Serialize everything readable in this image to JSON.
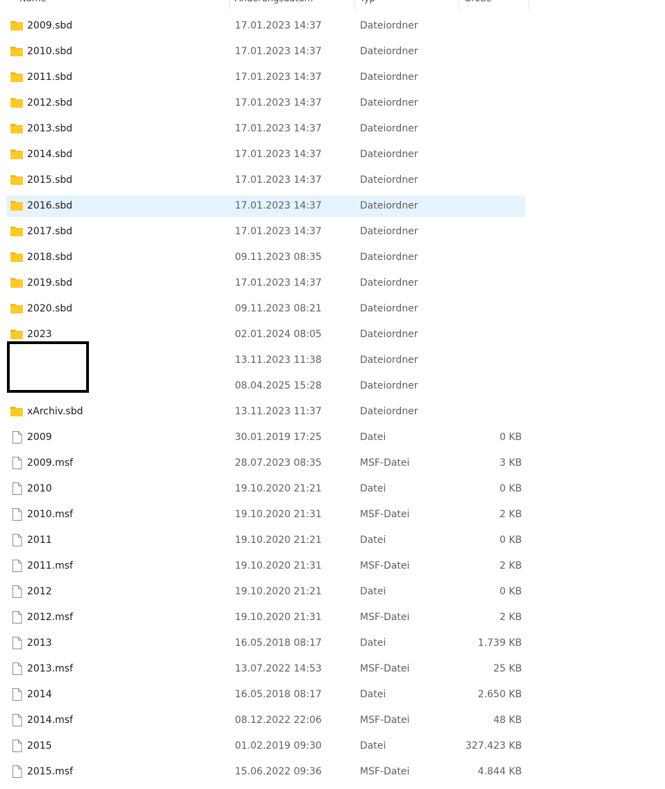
{
  "header": {
    "name": "Name",
    "date": "Änderungsdatum",
    "type": "Typ",
    "size": "Größe"
  },
  "rows": [
    {
      "name": "2009.sbd",
      "date": "17.01.2023 14:37",
      "type": "Dateiordner",
      "size": "",
      "icon": "folder-icon"
    },
    {
      "name": "2010.sbd",
      "date": "17.01.2023 14:37",
      "type": "Dateiordner",
      "size": "",
      "icon": "folder-icon"
    },
    {
      "name": "2011.sbd",
      "date": "17.01.2023 14:37",
      "type": "Dateiordner",
      "size": "",
      "icon": "folder-icon"
    },
    {
      "name": "2012.sbd",
      "date": "17.01.2023 14:37",
      "type": "Dateiordner",
      "size": "",
      "icon": "folder-icon"
    },
    {
      "name": "2013.sbd",
      "date": "17.01.2023 14:37",
      "type": "Dateiordner",
      "size": "",
      "icon": "folder-icon"
    },
    {
      "name": "2014.sbd",
      "date": "17.01.2023 14:37",
      "type": "Dateiordner",
      "size": "",
      "icon": "folder-icon"
    },
    {
      "name": "2015.sbd",
      "date": "17.01.2023 14:37",
      "type": "Dateiordner",
      "size": "",
      "icon": "folder-icon"
    },
    {
      "name": "2016.sbd",
      "date": "17.01.2023 14:37",
      "type": "Dateiordner",
      "size": "",
      "icon": "folder-icon",
      "selected": true
    },
    {
      "name": "2017.sbd",
      "date": "17.01.2023 14:37",
      "type": "Dateiordner",
      "size": "",
      "icon": "folder-icon"
    },
    {
      "name": "2018.sbd",
      "date": "09.11.2023 08:35",
      "type": "Dateiordner",
      "size": "",
      "icon": "folder-icon"
    },
    {
      "name": "2019.sbd",
      "date": "17.01.2023 14:37",
      "type": "Dateiordner",
      "size": "",
      "icon": "folder-icon"
    },
    {
      "name": "2020.sbd",
      "date": "09.11.2023 08:21",
      "type": "Dateiordner",
      "size": "",
      "icon": "folder-icon"
    },
    {
      "name": "2023",
      "date": "02.01.2024 08:05",
      "type": "Dateiordner",
      "size": "",
      "icon": "folder-icon"
    },
    {
      "name": "",
      "date": "13.11.2023 11:38",
      "type": "Dateiordner",
      "size": "",
      "icon": ""
    },
    {
      "name": "",
      "date": "08.04.2025 15:28",
      "type": "Dateiordner",
      "size": "",
      "icon": ""
    },
    {
      "name": "xArchiv.sbd",
      "date": "13.11.2023 11:37",
      "type": "Dateiordner",
      "size": "",
      "icon": "folder-icon"
    },
    {
      "name": "2009",
      "date": "30.01.2019 17:25",
      "type": "Datei",
      "size": "0 KB",
      "icon": "file-icon"
    },
    {
      "name": "2009.msf",
      "date": "28.07.2023 08:35",
      "type": "MSF-Datei",
      "size": "3 KB",
      "icon": "file-icon"
    },
    {
      "name": "2010",
      "date": "19.10.2020 21:21",
      "type": "Datei",
      "size": "0 KB",
      "icon": "file-icon"
    },
    {
      "name": "2010.msf",
      "date": "19.10.2020 21:31",
      "type": "MSF-Datei",
      "size": "2 KB",
      "icon": "file-icon"
    },
    {
      "name": "2011",
      "date": "19.10.2020 21:21",
      "type": "Datei",
      "size": "0 KB",
      "icon": "file-icon"
    },
    {
      "name": "2011.msf",
      "date": "19.10.2020 21:31",
      "type": "MSF-Datei",
      "size": "2 KB",
      "icon": "file-icon"
    },
    {
      "name": "2012",
      "date": "19.10.2020 21:21",
      "type": "Datei",
      "size": "0 KB",
      "icon": "file-icon"
    },
    {
      "name": "2012.msf",
      "date": "19.10.2020 21:31",
      "type": "MSF-Datei",
      "size": "2 KB",
      "icon": "file-icon"
    },
    {
      "name": "2013",
      "date": "16.05.2018 08:17",
      "type": "Datei",
      "size": "1.739 KB",
      "icon": "file-icon"
    },
    {
      "name": "2013.msf",
      "date": "13.07.2022 14:53",
      "type": "MSF-Datei",
      "size": "25 KB",
      "icon": "file-icon"
    },
    {
      "name": "2014",
      "date": "16.05.2018 08:17",
      "type": "Datei",
      "size": "2.650 KB",
      "icon": "file-icon"
    },
    {
      "name": "2014.msf",
      "date": "08.12.2022 22:06",
      "type": "MSF-Datei",
      "size": "48 KB",
      "icon": "file-icon"
    },
    {
      "name": "2015",
      "date": "01.02.2019 09:30",
      "type": "Datei",
      "size": "327.423 KB",
      "icon": "file-icon"
    },
    {
      "name": "2015.msf",
      "date": "15.06.2022 09:36",
      "type": "MSF-Datei",
      "size": "4.844 KB",
      "icon": "file-icon"
    }
  ],
  "colors": {
    "selected_row": "#e5f3ff",
    "folder_body": "#ffca28",
    "folder_tab": "#f0b429",
    "secondary_text": "#5f5f5f"
  }
}
